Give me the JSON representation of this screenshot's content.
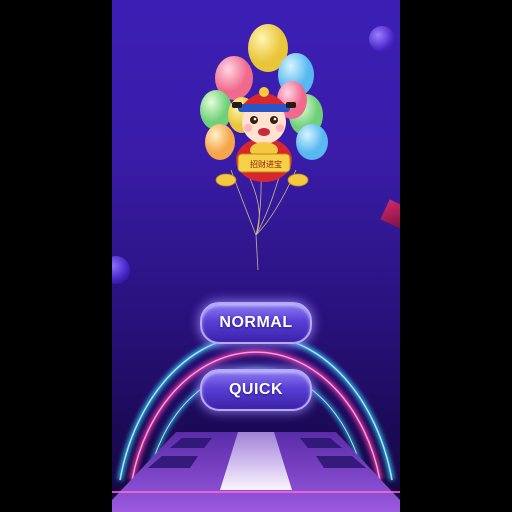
{
  "buttons": {
    "normal_label": "NORMAL",
    "quick_label": "QUICK"
  },
  "mascot": {
    "scroll_text": "招财进宝",
    "icon": "fortune-god-balloons-icon"
  },
  "colors": {
    "background_top": "#3b1fb5",
    "background_bottom": "#160840",
    "neon_cyan": "#39d7ff",
    "neon_pink": "#ff3fb0",
    "button_border": "#b8a8ff"
  }
}
